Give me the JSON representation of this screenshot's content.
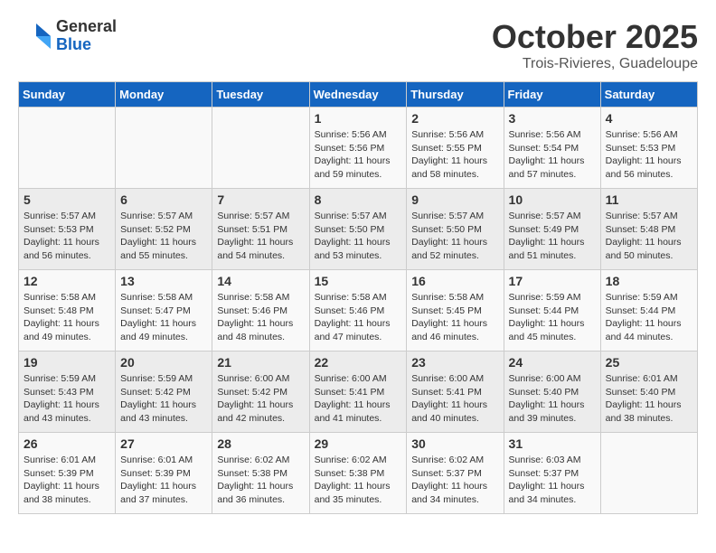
{
  "logo": {
    "general": "General",
    "blue": "Blue"
  },
  "title": "October 2025",
  "location": "Trois-Rivieres, Guadeloupe",
  "days_header": [
    "Sunday",
    "Monday",
    "Tuesday",
    "Wednesday",
    "Thursday",
    "Friday",
    "Saturday"
  ],
  "weeks": [
    [
      {
        "day": "",
        "info": ""
      },
      {
        "day": "",
        "info": ""
      },
      {
        "day": "",
        "info": ""
      },
      {
        "day": "1",
        "info": "Sunrise: 5:56 AM\nSunset: 5:56 PM\nDaylight: 11 hours\nand 59 minutes."
      },
      {
        "day": "2",
        "info": "Sunrise: 5:56 AM\nSunset: 5:55 PM\nDaylight: 11 hours\nand 58 minutes."
      },
      {
        "day": "3",
        "info": "Sunrise: 5:56 AM\nSunset: 5:54 PM\nDaylight: 11 hours\nand 57 minutes."
      },
      {
        "day": "4",
        "info": "Sunrise: 5:56 AM\nSunset: 5:53 PM\nDaylight: 11 hours\nand 56 minutes."
      }
    ],
    [
      {
        "day": "5",
        "info": "Sunrise: 5:57 AM\nSunset: 5:53 PM\nDaylight: 11 hours\nand 56 minutes."
      },
      {
        "day": "6",
        "info": "Sunrise: 5:57 AM\nSunset: 5:52 PM\nDaylight: 11 hours\nand 55 minutes."
      },
      {
        "day": "7",
        "info": "Sunrise: 5:57 AM\nSunset: 5:51 PM\nDaylight: 11 hours\nand 54 minutes."
      },
      {
        "day": "8",
        "info": "Sunrise: 5:57 AM\nSunset: 5:50 PM\nDaylight: 11 hours\nand 53 minutes."
      },
      {
        "day": "9",
        "info": "Sunrise: 5:57 AM\nSunset: 5:50 PM\nDaylight: 11 hours\nand 52 minutes."
      },
      {
        "day": "10",
        "info": "Sunrise: 5:57 AM\nSunset: 5:49 PM\nDaylight: 11 hours\nand 51 minutes."
      },
      {
        "day": "11",
        "info": "Sunrise: 5:57 AM\nSunset: 5:48 PM\nDaylight: 11 hours\nand 50 minutes."
      }
    ],
    [
      {
        "day": "12",
        "info": "Sunrise: 5:58 AM\nSunset: 5:48 PM\nDaylight: 11 hours\nand 49 minutes."
      },
      {
        "day": "13",
        "info": "Sunrise: 5:58 AM\nSunset: 5:47 PM\nDaylight: 11 hours\nand 49 minutes."
      },
      {
        "day": "14",
        "info": "Sunrise: 5:58 AM\nSunset: 5:46 PM\nDaylight: 11 hours\nand 48 minutes."
      },
      {
        "day": "15",
        "info": "Sunrise: 5:58 AM\nSunset: 5:46 PM\nDaylight: 11 hours\nand 47 minutes."
      },
      {
        "day": "16",
        "info": "Sunrise: 5:58 AM\nSunset: 5:45 PM\nDaylight: 11 hours\nand 46 minutes."
      },
      {
        "day": "17",
        "info": "Sunrise: 5:59 AM\nSunset: 5:44 PM\nDaylight: 11 hours\nand 45 minutes."
      },
      {
        "day": "18",
        "info": "Sunrise: 5:59 AM\nSunset: 5:44 PM\nDaylight: 11 hours\nand 44 minutes."
      }
    ],
    [
      {
        "day": "19",
        "info": "Sunrise: 5:59 AM\nSunset: 5:43 PM\nDaylight: 11 hours\nand 43 minutes."
      },
      {
        "day": "20",
        "info": "Sunrise: 5:59 AM\nSunset: 5:42 PM\nDaylight: 11 hours\nand 43 minutes."
      },
      {
        "day": "21",
        "info": "Sunrise: 6:00 AM\nSunset: 5:42 PM\nDaylight: 11 hours\nand 42 minutes."
      },
      {
        "day": "22",
        "info": "Sunrise: 6:00 AM\nSunset: 5:41 PM\nDaylight: 11 hours\nand 41 minutes."
      },
      {
        "day": "23",
        "info": "Sunrise: 6:00 AM\nSunset: 5:41 PM\nDaylight: 11 hours\nand 40 minutes."
      },
      {
        "day": "24",
        "info": "Sunrise: 6:00 AM\nSunset: 5:40 PM\nDaylight: 11 hours\nand 39 minutes."
      },
      {
        "day": "25",
        "info": "Sunrise: 6:01 AM\nSunset: 5:40 PM\nDaylight: 11 hours\nand 38 minutes."
      }
    ],
    [
      {
        "day": "26",
        "info": "Sunrise: 6:01 AM\nSunset: 5:39 PM\nDaylight: 11 hours\nand 38 minutes."
      },
      {
        "day": "27",
        "info": "Sunrise: 6:01 AM\nSunset: 5:39 PM\nDaylight: 11 hours\nand 37 minutes."
      },
      {
        "day": "28",
        "info": "Sunrise: 6:02 AM\nSunset: 5:38 PM\nDaylight: 11 hours\nand 36 minutes."
      },
      {
        "day": "29",
        "info": "Sunrise: 6:02 AM\nSunset: 5:38 PM\nDaylight: 11 hours\nand 35 minutes."
      },
      {
        "day": "30",
        "info": "Sunrise: 6:02 AM\nSunset: 5:37 PM\nDaylight: 11 hours\nand 34 minutes."
      },
      {
        "day": "31",
        "info": "Sunrise: 6:03 AM\nSunset: 5:37 PM\nDaylight: 11 hours\nand 34 minutes."
      },
      {
        "day": "",
        "info": ""
      }
    ]
  ]
}
